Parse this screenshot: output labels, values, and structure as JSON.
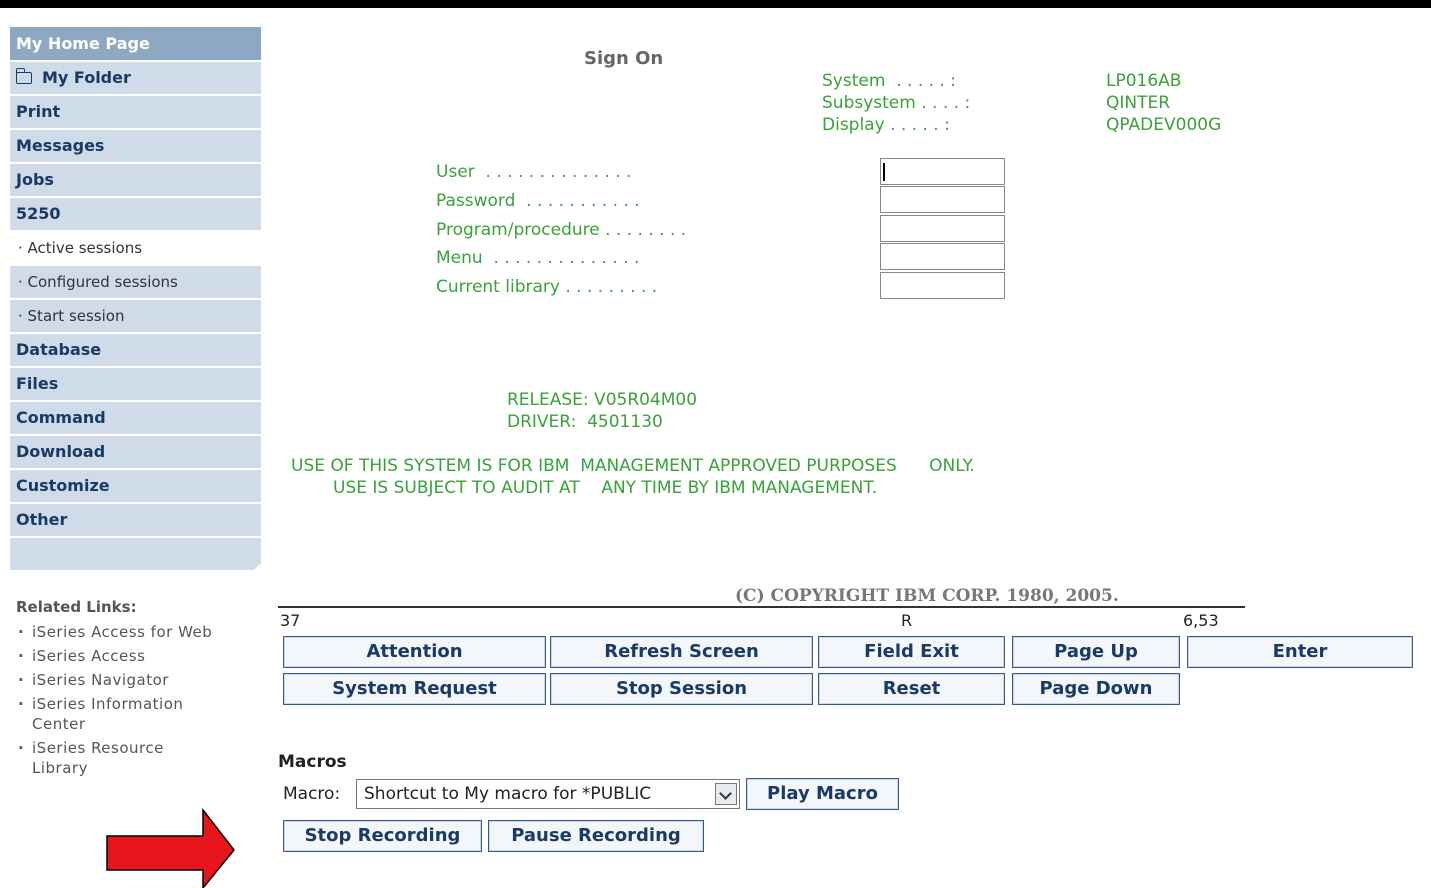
{
  "sidebar": {
    "header": "My Home Page",
    "folder": "My Folder",
    "items": [
      {
        "label": "Print"
      },
      {
        "label": "Messages"
      },
      {
        "label": "Jobs"
      },
      {
        "label": "5250"
      }
    ],
    "sub_items": [
      {
        "label": "· Active sessions"
      },
      {
        "label": "· Configured sessions"
      },
      {
        "label": "· Start session"
      }
    ],
    "items2": [
      {
        "label": "Database"
      },
      {
        "label": "Files"
      },
      {
        "label": "Command"
      },
      {
        "label": "Download"
      },
      {
        "label": "Customize"
      },
      {
        "label": "Other"
      }
    ]
  },
  "related": {
    "title": "Related Links:",
    "links": [
      "iSeries Access for Web",
      "iSeries Access",
      "iSeries Navigator",
      "iSeries Information Center",
      "iSeries Resource Library"
    ]
  },
  "screen": {
    "title": "Sign On",
    "system_labels": [
      "System  . . . . . :",
      "Subsystem . . . . :",
      "Display . . . . . :"
    ],
    "system_values": [
      "LP016AB",
      "QINTER",
      "QPADEV000G"
    ],
    "field_labels": [
      "User  . . . . . . . . . . . . . .",
      "Password  . . . . . . . . . . .",
      "Program/procedure . . . . . . . .",
      "Menu  . . . . . . . . . . . . . .",
      "Current library . . . . . . . . ."
    ],
    "release": "RELEASE: V05R04M00",
    "driver": "DRIVER:  4501130",
    "notice1": "USE OF THIS SYSTEM IS FOR IBM  MANAGEMENT APPROVED PURPOSES      ONLY.",
    "notice2": "USE IS SUBJECT TO AUDIT AT    ANY TIME BY IBM MANAGEMENT.",
    "copyright": "(C) COPYRIGHT IBM CORP. 1980, 2005."
  },
  "status": {
    "left": "37",
    "mid": "R",
    "right": "6,53"
  },
  "buttons": {
    "attention": "Attention",
    "refresh": "Refresh Screen",
    "field_exit": "Field Exit",
    "page_up": "Page Up",
    "enter": "Enter",
    "system_request": "System Request",
    "stop_session": "Stop Session",
    "reset": "Reset",
    "page_down": "Page Down"
  },
  "macros": {
    "title": "Macros",
    "label": "Macro:",
    "selected": "Shortcut to My macro for *PUBLIC",
    "play": "Play Macro",
    "stop_recording": "Stop Recording",
    "pause_recording": "Pause Recording"
  },
  "colors": {
    "terminal_green": "#3aa13a",
    "nav_bg": "#cfdbe8",
    "nav_header": "#8ea7c3",
    "arrow": "#e8161c"
  }
}
